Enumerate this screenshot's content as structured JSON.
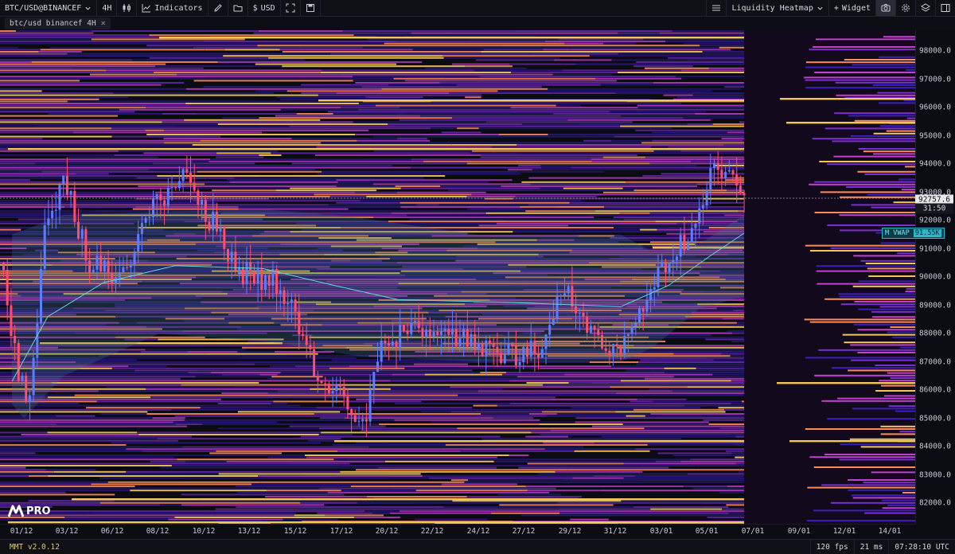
{
  "toolbar": {
    "symbol": "BTC/USD@BINANCEF",
    "timeframe": "4H",
    "indicators_label": "Indicators",
    "currency_label": "USD",
    "heatmap_label": "Liquidity Heatmap",
    "widget_label": "Widget"
  },
  "tab": {
    "label": "btc/usd binancef 4H"
  },
  "price_axis": {
    "labels": [
      "98000.0",
      "97000.0",
      "96000.0",
      "95000.0",
      "94000.0",
      "93000.0",
      "92000.0",
      "91000.0",
      "90000.0",
      "89000.0",
      "88000.0",
      "87000.0",
      "86000.0",
      "85000.0",
      "84000.0",
      "83000.0",
      "82000.0"
    ],
    "current_price": "92757.6",
    "countdown": "31:50",
    "vwap_label": "M VWAP",
    "vwap_value": "91.55K"
  },
  "time_axis": {
    "labels": [
      "01/12",
      "03/12",
      "06/12",
      "08/12",
      "10/12",
      "13/12",
      "15/12",
      "17/12",
      "20/12",
      "22/12",
      "24/12",
      "27/12",
      "29/12",
      "31/12",
      "03/01",
      "05/01",
      "07/01",
      "09/01",
      "12/01",
      "14/01"
    ]
  },
  "status": {
    "version": "MMT v2.0.12",
    "fps": "120 fps",
    "latency": "21 ms",
    "clock": "07:28:10 UTC"
  },
  "logo": {
    "text": "PRO"
  },
  "colors": {
    "background": "#0b0b12",
    "heat_low": "#3a1fb8",
    "heat_mid": "#c23fd0",
    "heat_high": "#f2c75a",
    "bull": "#5b7dff",
    "bear": "#ff4d6d",
    "vwap": "#5fd8e0"
  },
  "icons": [
    "chevron-down-icon",
    "chart-line-icon",
    "pencil-icon",
    "folder-icon",
    "expand-icon",
    "save-icon",
    "menu-icon",
    "plus-icon",
    "camera-icon",
    "gear-icon",
    "layers-icon",
    "sidebar-icon",
    "close-icon"
  ]
}
